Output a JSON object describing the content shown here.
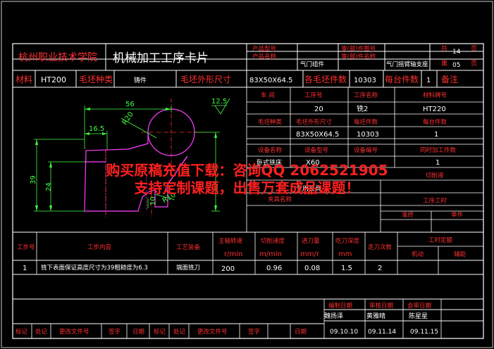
{
  "header": {
    "school": "杭州职业技术学院",
    "title": "机械加工工序卡片",
    "product_model_label": "产品型号",
    "product_name_label": "产品名称",
    "product_name": "气门组件",
    "part_drawing_label": "零(部)件图号",
    "part_name_label": "零(部)件名称",
    "part_name": "气门摇臂轴支座",
    "total_label": "共",
    "total_pages": "14",
    "page_unit": "页",
    "sheet_label": "第",
    "sheet_no": "05",
    "sheet_unit": "页"
  },
  "row2": {
    "material_label": "材料",
    "material": "HT200",
    "blank_type_label": "毛坯种类",
    "blank_type": "铸件",
    "blank_size_label": "毛坯外形尺寸",
    "blank_size": "83X50X64.5",
    "pieces_per_blank_label": "各毛坯件数",
    "pieces_per_blank": "10303",
    "per_machine_label": "每台件数",
    "per_machine": "1",
    "remark_label": "备注"
  },
  "info": {
    "workshop_label": "车 间",
    "process_no_label": "工序号",
    "process_name_label": "工序名称",
    "material_no_label": "材料牌号",
    "process_no": "20",
    "process_name": "铣2",
    "material_no": "HT220",
    "blank_type_label": "毛坯种类",
    "blank_size_label": "毛坯外形尺寸",
    "blank_pieces_label": "每坯件数",
    "per_machine_label": "每台件数",
    "blank_size": "83X50X64.5",
    "blank_pieces": "10303",
    "per_machine": "1",
    "equip_name_label": "设备名称",
    "equip_model_label": "设备型号",
    "equip_no_label": "设备编号",
    "simul_label": "同时加工件数",
    "equip_name": "卧式铣床",
    "equip_model": "X60",
    "simul": "1",
    "fixture_name": "专用夹具",
    "coolant_label": "切削液",
    "fixture_label": "夹具名称",
    "time_label": "工序工时",
    "quasi_label": "准终",
    "unit_label": "单件"
  },
  "drawing": {
    "dim_56": "56",
    "dim_165": "16.5",
    "dim_r20": "R20",
    "dim_39": "39",
    "dim_24": "24",
    "dim_10": "10",
    "dim_r10": "R10",
    "roughness": "12.5"
  },
  "steps": {
    "step_no_label": "工步号",
    "content_label": "工步内容",
    "equip_label": "工艺装备",
    "speed_label": "主轴转速",
    "speed_unit": "r/min",
    "cut_speed_label": "切削速度",
    "cut_speed_unit": "m/min",
    "feed_label": "进刀量",
    "feed_unit": "mm/r",
    "depth_label": "吃刀深度",
    "depth_unit": "mm",
    "passes_label": "走刀次数",
    "quota_label": "工时定额",
    "machine_label": "机动",
    "aux_label": "辅助",
    "rows": [
      {
        "no": "1",
        "content": "铣下表面保证高度尺寸为39粗糙度为6.3",
        "tool": "端面铣刀",
        "speed": "200",
        "cut_speed": "0.96",
        "feed": "0.08",
        "depth": "1.5",
        "passes": "2"
      }
    ]
  },
  "footer": {
    "design_date_label": "编制日期",
    "review_date_label": "审核日期",
    "sign_date_label": "会审日期",
    "design_by": "魏扬泽",
    "review_by": "黄雅晴",
    "sign_by": "陈星星",
    "design_date": "09.10.10",
    "review_date": "09.11.14",
    "sign_date": "09.11.15",
    "mark": "标记",
    "count": "处记",
    "change_doc": "更改文件号",
    "sign": "签字",
    "date": "日期"
  },
  "watermark": {
    "line1": "购买原稿充值下载：咨询QQ 2062521905",
    "line2": "支持定制课题，出售万套成品课题！"
  },
  "colors": {
    "line": "#ffffff",
    "red": "#ff3030",
    "magenta": "#ff40ff",
    "green": "#40ff40",
    "cyan": "#40ffff",
    "watermark": "#ff2020"
  }
}
